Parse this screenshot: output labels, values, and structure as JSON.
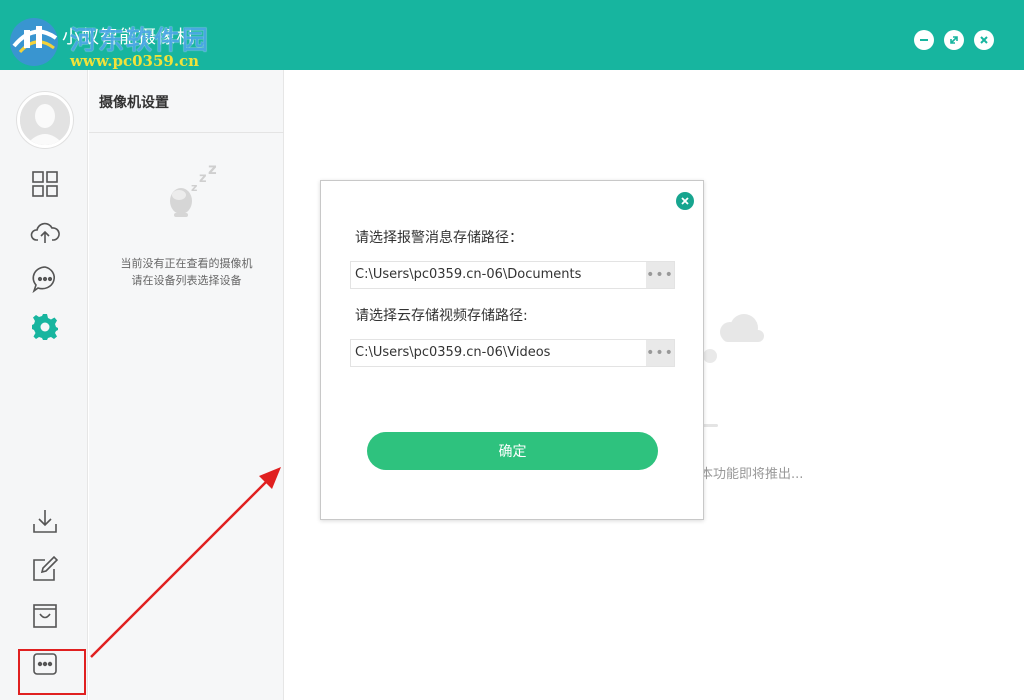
{
  "app": {
    "title": "小蚁智能摄像机",
    "watermark_text": "河东软件园",
    "watermark_url": "www.pc0359.cn",
    "window_buttons": [
      "minimize-icon",
      "restore-icon",
      "close-icon"
    ]
  },
  "sidebar": {
    "items": [
      {
        "name": "grid-icon"
      },
      {
        "name": "cloud-upload-icon"
      },
      {
        "name": "message-icon"
      },
      {
        "name": "settings-icon",
        "active": true
      },
      {
        "name": "download-icon"
      },
      {
        "name": "edit-icon"
      },
      {
        "name": "shop-icon"
      },
      {
        "name": "more-icon",
        "highlighted": true
      }
    ]
  },
  "panel": {
    "title": "摄像机设置",
    "empty_line1": "当前没有正在查看的摄像机",
    "empty_line2": "请在设备列表选择设备"
  },
  "main": {
    "background_text": "本功能即将推出..."
  },
  "dialog": {
    "alarm_label": "请选择报警消息存储路径：",
    "alarm_path": "C:\\Users\\pc0359.cn-06\\Documents",
    "cloud_label": "请选择云存储视频存储路径:",
    "cloud_path": "C:\\Users\\pc0359.cn-06\\Videos",
    "browse_label": "•••",
    "confirm_label": "确定"
  },
  "colors": {
    "accent": "#17b59f",
    "confirm": "#2ec27e",
    "annotation": "#e02020"
  }
}
